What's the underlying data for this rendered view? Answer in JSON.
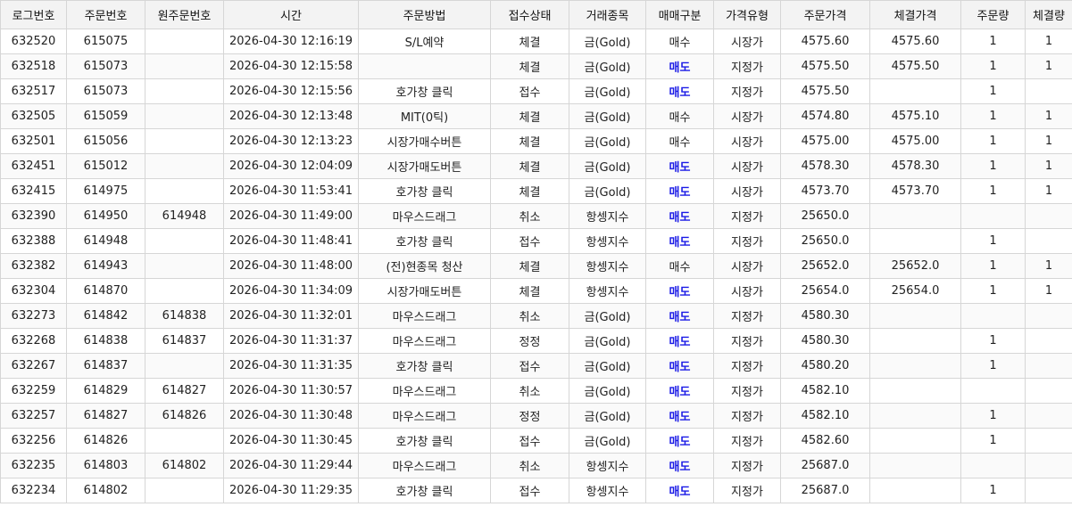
{
  "colors": {
    "sell": "#1a1ae6",
    "buy": "#222222",
    "header_bg": "#f3f3f3",
    "grid": "#d6d6d6"
  },
  "columns": [
    "로그번호",
    "주문번호",
    "원주문번호",
    "시간",
    "주문방법",
    "접수상태",
    "거래종목",
    "매매구분",
    "가격유형",
    "주문가격",
    "체결가격",
    "주문량",
    "체결량"
  ],
  "rows": [
    [
      "632520",
      "615075",
      "",
      "2026-04-30 12:16:19",
      "S/L예약",
      "체결",
      "금(Gold)",
      "매수",
      "시장가",
      "4575.60",
      "4575.60",
      "1",
      "1"
    ],
    [
      "632518",
      "615073",
      "",
      "2026-04-30 12:15:58",
      "",
      "체결",
      "금(Gold)",
      "매도",
      "지정가",
      "4575.50",
      "4575.50",
      "1",
      "1"
    ],
    [
      "632517",
      "615073",
      "",
      "2026-04-30 12:15:56",
      "호가창 클릭",
      "접수",
      "금(Gold)",
      "매도",
      "지정가",
      "4575.50",
      "",
      "1",
      ""
    ],
    [
      "632505",
      "615059",
      "",
      "2026-04-30 12:13:48",
      "MIT(0틱)",
      "체결",
      "금(Gold)",
      "매수",
      "시장가",
      "4574.80",
      "4575.10",
      "1",
      "1"
    ],
    [
      "632501",
      "615056",
      "",
      "2026-04-30 12:13:23",
      "시장가매수버튼",
      "체결",
      "금(Gold)",
      "매수",
      "시장가",
      "4575.00",
      "4575.00",
      "1",
      "1"
    ],
    [
      "632451",
      "615012",
      "",
      "2026-04-30 12:04:09",
      "시장가매도버튼",
      "체결",
      "금(Gold)",
      "매도",
      "시장가",
      "4578.30",
      "4578.30",
      "1",
      "1"
    ],
    [
      "632415",
      "614975",
      "",
      "2026-04-30 11:53:41",
      "호가창 클릭",
      "체결",
      "금(Gold)",
      "매도",
      "시장가",
      "4573.70",
      "4573.70",
      "1",
      "1"
    ],
    [
      "632390",
      "614950",
      "614948",
      "2026-04-30 11:49:00",
      "마우스드래그",
      "취소",
      "항셍지수",
      "매도",
      "지정가",
      "25650.0",
      "",
      "",
      ""
    ],
    [
      "632388",
      "614948",
      "",
      "2026-04-30 11:48:41",
      "호가창 클릭",
      "접수",
      "항셍지수",
      "매도",
      "지정가",
      "25650.0",
      "",
      "1",
      ""
    ],
    [
      "632382",
      "614943",
      "",
      "2026-04-30 11:48:00",
      "(전)현종목 청산",
      "체결",
      "항셍지수",
      "매수",
      "시장가",
      "25652.0",
      "25652.0",
      "1",
      "1"
    ],
    [
      "632304",
      "614870",
      "",
      "2026-04-30 11:34:09",
      "시장가매도버튼",
      "체결",
      "항셍지수",
      "매도",
      "시장가",
      "25654.0",
      "25654.0",
      "1",
      "1"
    ],
    [
      "632273",
      "614842",
      "614838",
      "2026-04-30 11:32:01",
      "마우스드래그",
      "취소",
      "금(Gold)",
      "매도",
      "지정가",
      "4580.30",
      "",
      "",
      ""
    ],
    [
      "632268",
      "614838",
      "614837",
      "2026-04-30 11:31:37",
      "마우스드래그",
      "정정",
      "금(Gold)",
      "매도",
      "지정가",
      "4580.30",
      "",
      "1",
      ""
    ],
    [
      "632267",
      "614837",
      "",
      "2026-04-30 11:31:35",
      "호가창 클릭",
      "접수",
      "금(Gold)",
      "매도",
      "지정가",
      "4580.20",
      "",
      "1",
      ""
    ],
    [
      "632259",
      "614829",
      "614827",
      "2026-04-30 11:30:57",
      "마우스드래그",
      "취소",
      "금(Gold)",
      "매도",
      "지정가",
      "4582.10",
      "",
      "",
      ""
    ],
    [
      "632257",
      "614827",
      "614826",
      "2026-04-30 11:30:48",
      "마우스드래그",
      "정정",
      "금(Gold)",
      "매도",
      "지정가",
      "4582.10",
      "",
      "1",
      ""
    ],
    [
      "632256",
      "614826",
      "",
      "2026-04-30 11:30:45",
      "호가창 클릭",
      "접수",
      "금(Gold)",
      "매도",
      "지정가",
      "4582.60",
      "",
      "1",
      ""
    ],
    [
      "632235",
      "614803",
      "614802",
      "2026-04-30 11:29:44",
      "마우스드래그",
      "취소",
      "항셍지수",
      "매도",
      "지정가",
      "25687.0",
      "",
      "",
      ""
    ],
    [
      "632234",
      "614802",
      "",
      "2026-04-30 11:29:35",
      "호가창 클릭",
      "접수",
      "항셍지수",
      "매도",
      "지정가",
      "25687.0",
      "",
      "1",
      ""
    ]
  ]
}
